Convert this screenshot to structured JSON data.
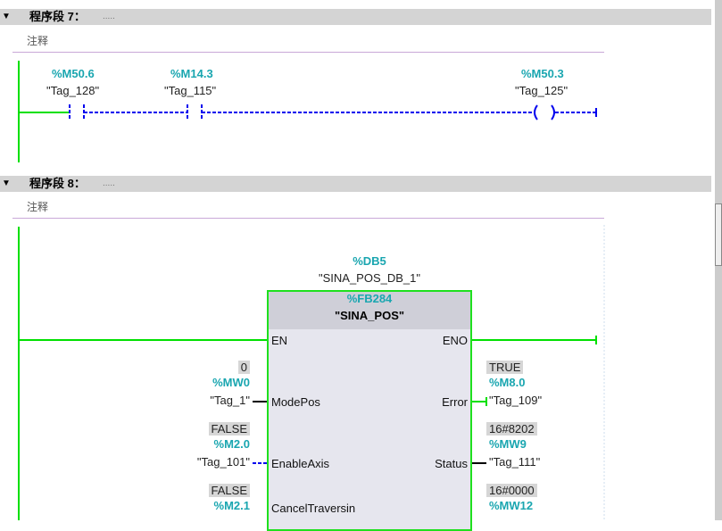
{
  "networks": [
    {
      "title": "程序段 7：",
      "dots": ".....",
      "comment": "注释",
      "contacts": [
        {
          "address": "%M50.6",
          "symbol": "\"Tag_128\""
        },
        {
          "address": "%M14.3",
          "symbol": "\"Tag_115\""
        }
      ],
      "coil": {
        "address": "%M50.3",
        "symbol": "\"Tag_125\"",
        "type": "S"
      }
    },
    {
      "title": "程序段 8：",
      "dots": ".....",
      "comment": "注释",
      "block": {
        "instance_address": "%DB5",
        "instance_symbol": "\"SINA_POS_DB_1\"",
        "fb_address": "%FB284",
        "fb_name": "\"SINA_POS\"",
        "en": "EN",
        "eno": "ENO",
        "inputs": [
          {
            "pin": "ModePos",
            "value": "0",
            "address": "%MW0",
            "symbol": "\"Tag_1\""
          },
          {
            "pin": "EnableAxis",
            "value": "FALSE",
            "address": "%M2.0",
            "symbol": "\"Tag_101\""
          },
          {
            "pin": "CancelTraversin",
            "value": "FALSE",
            "address": "%M2.1"
          }
        ],
        "outputs": [
          {
            "pin": "Error",
            "value": "TRUE",
            "address": "%M8.0",
            "symbol": "\"Tag_109\""
          },
          {
            "pin": "Status",
            "value": "16#8202",
            "address": "%MW9",
            "symbol": "\"Tag_111\""
          },
          {
            "value": "16#0000",
            "address": "%MW12"
          }
        ]
      }
    }
  ]
}
